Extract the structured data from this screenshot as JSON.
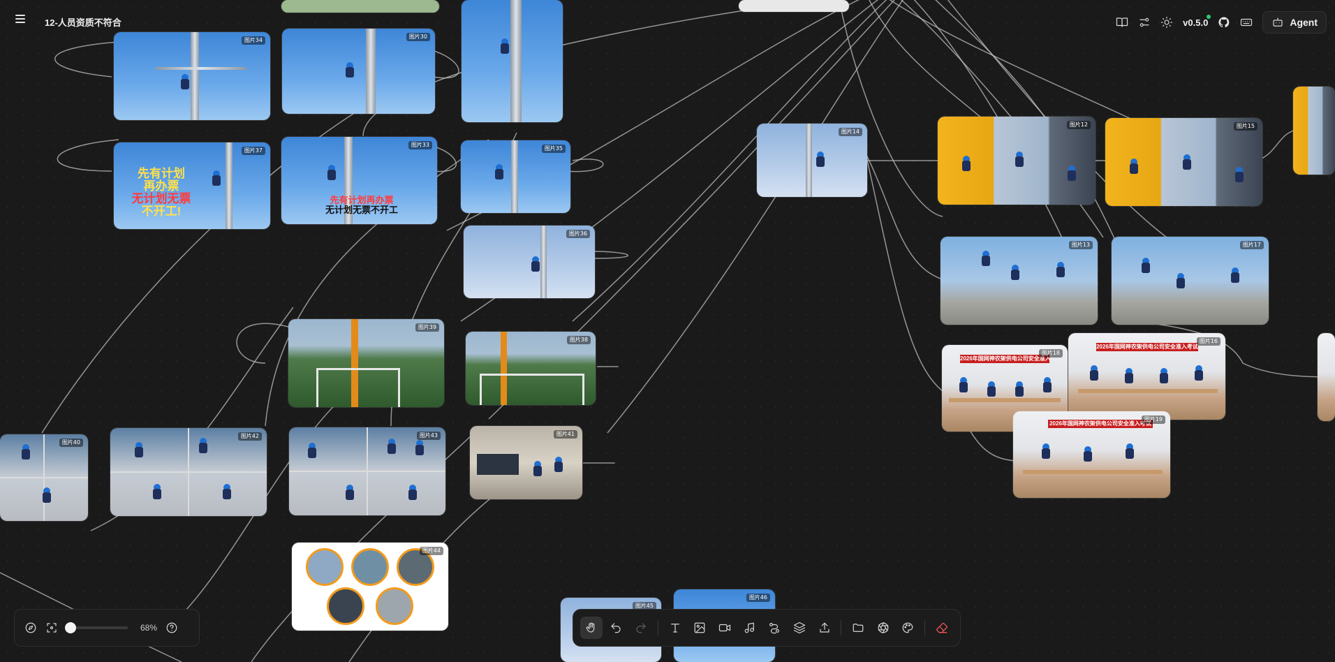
{
  "header": {
    "title": "12-人员资质不符合",
    "version": "v0.5.0",
    "agent_label": "Agent",
    "icons": [
      "book-icon",
      "sliders-icon",
      "sun-icon",
      "github-icon",
      "keyboard-icon",
      "bot-icon"
    ]
  },
  "cards": {
    "c34": {
      "badge": "图片34"
    },
    "c30": {
      "badge": "图片30"
    },
    "c37": {
      "badge": "图片37",
      "slogan": [
        "先有计划",
        "再办票",
        "无计划无票",
        "不开工!"
      ]
    },
    "c33": {
      "badge": "图片33",
      "slogan": [
        "先有计划再办票",
        "无计划无票不开工"
      ]
    },
    "c35": {
      "badge": "图片35"
    },
    "c36": {
      "badge": "图片36"
    },
    "c14": {
      "badge": "图片14"
    },
    "c12": {
      "badge": "图片12"
    },
    "c15": {
      "badge": "图片15"
    },
    "c13": {
      "badge": "图片13"
    },
    "c17": {
      "badge": "图片17"
    },
    "c39": {
      "badge": "图片39"
    },
    "c38": {
      "badge": "图片38"
    },
    "c41": {
      "badge": "图片41"
    },
    "c18": {
      "badge": "图片18",
      "banner": "2026年国网神农架供电公司安全准入考试"
    },
    "c16": {
      "badge": "图片16",
      "banner": "2026年国网神农架供电公司安全准入考试"
    },
    "c19": {
      "badge": "图片19",
      "banner": "2026年国网神农架供电公司安全准入考试"
    },
    "c45": {
      "badge": "图片45"
    },
    "c46": {
      "badge": "图片46"
    }
  },
  "zoom": {
    "value_label": "68%",
    "level": 0.068
  },
  "toolbar": {
    "tools": [
      "hand-icon",
      "undo-icon",
      "redo-icon",
      "text-icon",
      "image-icon",
      "video-icon",
      "music-icon",
      "connect-icon",
      "layers-icon",
      "upload-icon",
      "folder-icon",
      "aperture-icon",
      "palette-icon",
      "eraser-icon"
    ]
  },
  "colors": {
    "canvas": "#1a1a1a",
    "panel": "#1c1c1c",
    "connector": "#bfbfbf",
    "eraser": "#ff5a5a",
    "status_dot": "#2ecc71"
  }
}
